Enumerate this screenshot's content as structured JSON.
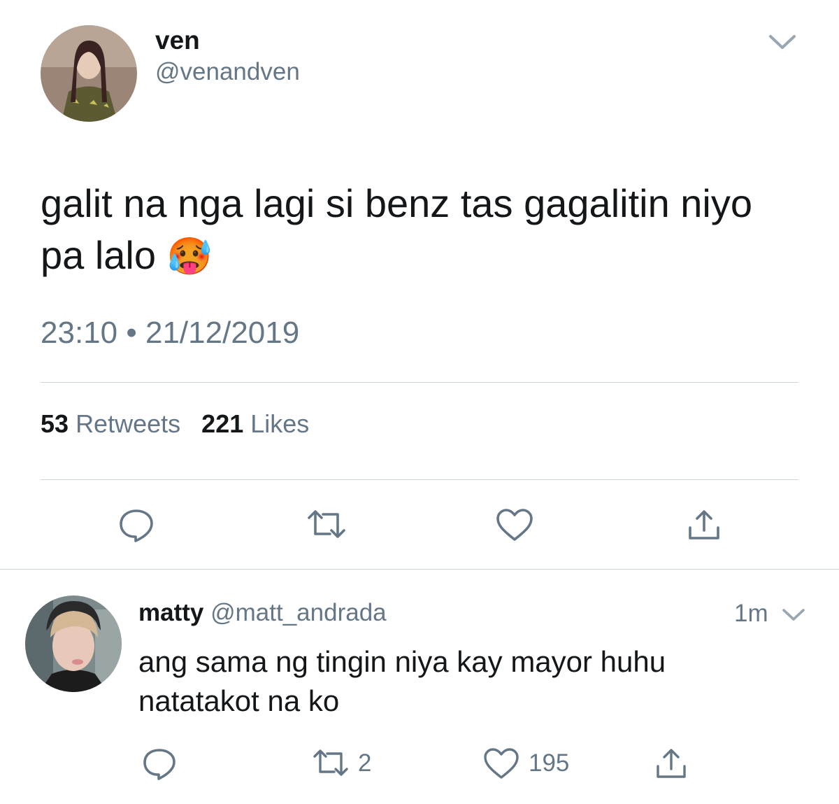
{
  "main_tweet": {
    "display_name": "ven",
    "handle": "@venandven",
    "text_line1": "galit na nga lagi si benz tas gagalitin niyo",
    "text_line2": "pa lalo",
    "emoji": "🥵",
    "time": "23:10",
    "separator": "•",
    "date": "21/12/2019",
    "retweets_count": "53",
    "retweets_label": "Retweets",
    "likes_count": "221",
    "likes_label": "Likes"
  },
  "reply": {
    "display_name": "matty",
    "handle": "@matt_andrada",
    "age": "1m",
    "text_line1": "ang sama ng tingin niya kay mayor huhu",
    "text_line2": "natatakot na ko",
    "retweet_count": "2",
    "like_count": "195"
  },
  "icons": {
    "menu": "chevron-down-icon",
    "reply": "reply-icon",
    "retweet": "retweet-icon",
    "like": "heart-icon",
    "share": "share-icon"
  },
  "colors": {
    "text": "#14171a",
    "secondary": "#657786",
    "divider": "#ccd6dd"
  }
}
